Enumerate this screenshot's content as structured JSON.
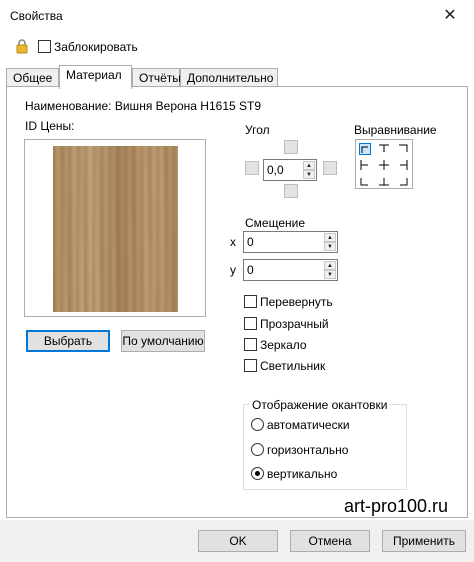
{
  "window": {
    "title": "Свойства",
    "close_glyph": "✕"
  },
  "lock": {
    "label": "Заблокировать",
    "checked": false,
    "icon": "lock-icon"
  },
  "tabs": [
    {
      "label": "Общее",
      "active": false
    },
    {
      "label": "Материал",
      "active": true
    },
    {
      "label": "Отчёты",
      "active": false
    },
    {
      "label": "Дополнительно",
      "active": false
    }
  ],
  "material": {
    "name_line": "Наименование: Вишня Верона H1615 ST9",
    "price_id_label": "ID Цены:",
    "select_button": "Выбрать",
    "default_button": "По умолчанию"
  },
  "angle": {
    "label": "Угол",
    "value": "0,0"
  },
  "alignment": {
    "label": "Выравнивание"
  },
  "offset": {
    "label": "Смещение",
    "x_label": "x",
    "x_value": "0",
    "y_label": "y",
    "y_value": "0"
  },
  "options": [
    {
      "label": "Перевернуть",
      "checked": false
    },
    {
      "label": "Прозрачный",
      "checked": false
    },
    {
      "label": "Зеркало",
      "checked": false
    },
    {
      "label": "Светильник",
      "checked": false
    }
  ],
  "edging": {
    "legend": "Отображение окантовки",
    "choices": [
      {
        "label": "автоматически",
        "selected": false
      },
      {
        "label": "горизонтально",
        "selected": false
      },
      {
        "label": "вертикально",
        "selected": true
      }
    ]
  },
  "footer": {
    "ok": "OK",
    "cancel": "Отмена",
    "apply": "Применить"
  },
  "watermark": "art-pro100.ru",
  "colors": {
    "accent": "#0078d7",
    "panel_border": "#adadad",
    "wood": "#b08d60"
  }
}
